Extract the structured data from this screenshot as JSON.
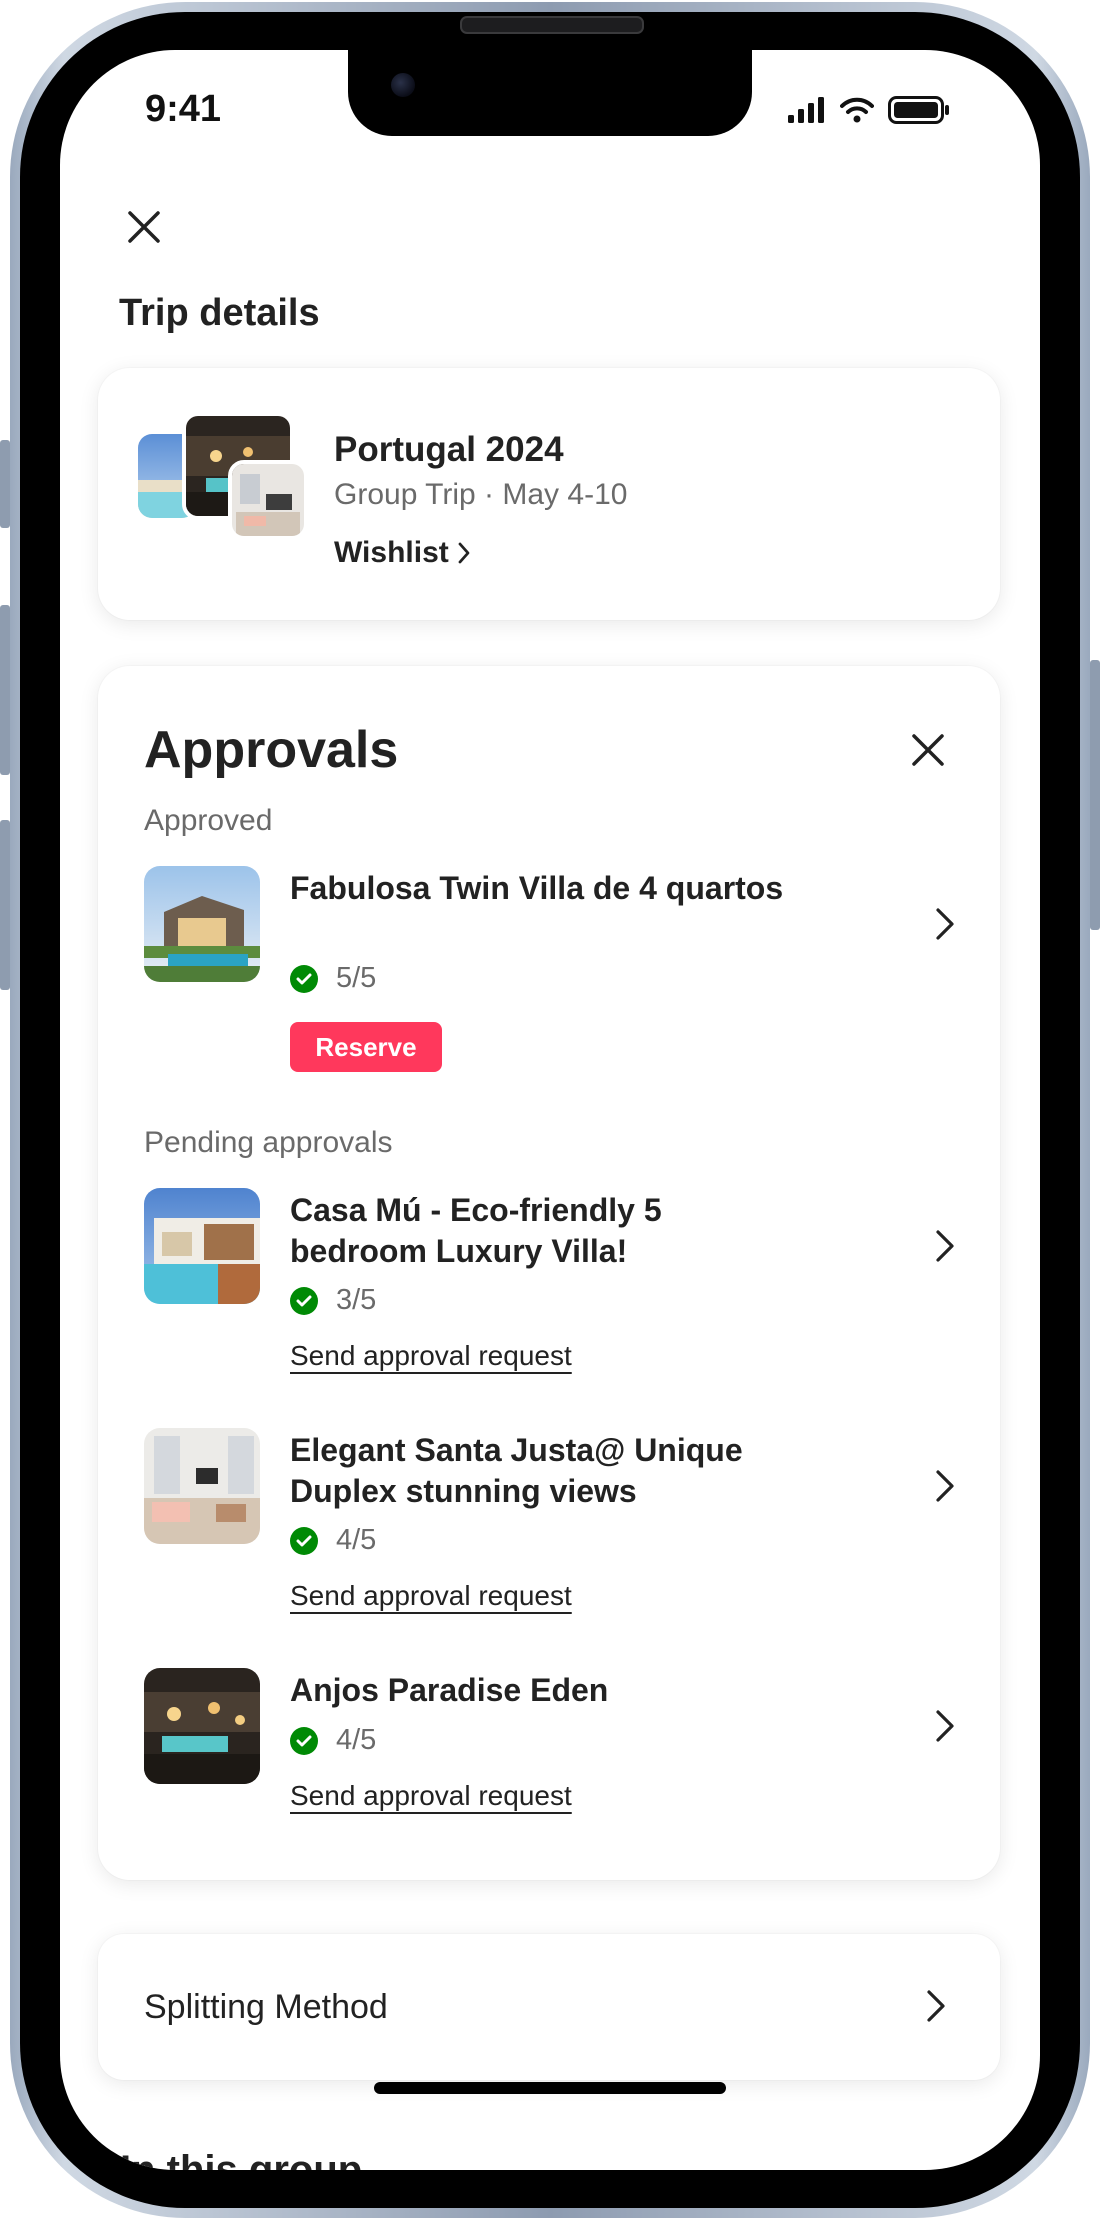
{
  "status_bar": {
    "time": "9:41"
  },
  "header": {
    "title": "Trip details"
  },
  "trip": {
    "name": "Portugal 2024",
    "subtitle": "Group Trip · May 4-10",
    "wishlist_label": "Wishlist"
  },
  "approvals": {
    "title": "Approvals",
    "approved_label": "Approved",
    "pending_label": "Pending approvals",
    "approved": [
      {
        "title": "Fabulosa Twin Villa de 4 quartos",
        "rating": "5/5",
        "action": "Reserve"
      }
    ],
    "pending": [
      {
        "title": "Casa Mú - Eco-friendly 5 bedroom Luxury Villa!",
        "rating": "3/5",
        "action": "Send approval request"
      },
      {
        "title": "Elegant Santa Justa@ Unique Duplex stunning views",
        "rating": "4/5",
        "action": "Send approval request"
      },
      {
        "title": "Anjos Paradise Eden",
        "rating": "4/5",
        "action": "Send approval request"
      }
    ]
  },
  "splitting": {
    "label": "Splitting Method"
  },
  "next_section": {
    "heading_partial": "In this group"
  },
  "colors": {
    "accent": "#ff385c",
    "check": "#008a05",
    "muted_text": "#6a6a6a"
  }
}
